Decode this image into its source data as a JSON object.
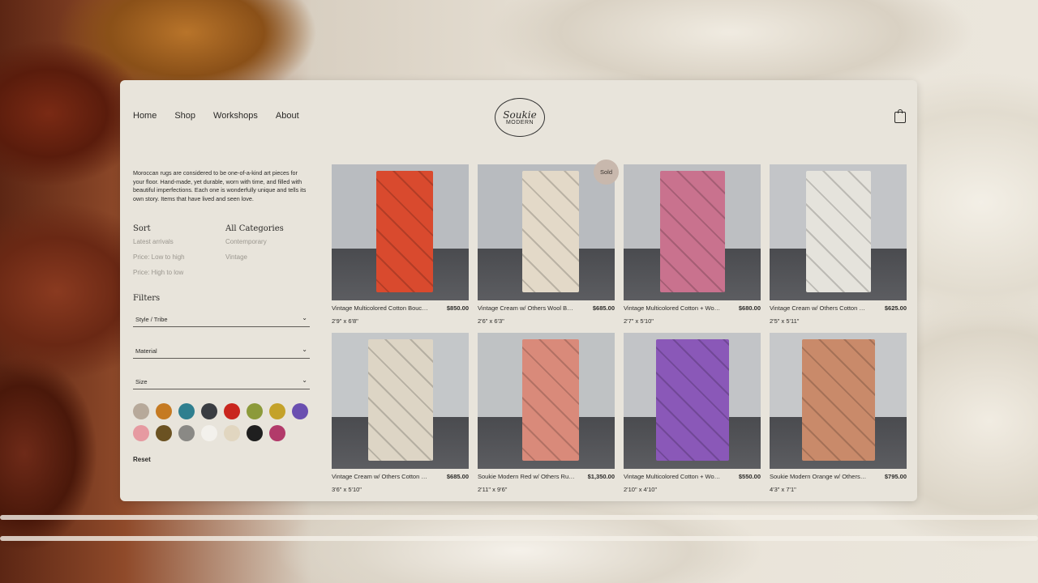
{
  "nav": {
    "items": [
      "Home",
      "Shop",
      "Workshops",
      "About"
    ]
  },
  "logo": {
    "line1": "Soukie",
    "line2": "MODERN"
  },
  "intro": "Moroccan rugs are considered to be one-of-a-kind art pieces for your floor. Hand-made, yet durable, worn with time, and filled with beautiful imperfections. Each one is wonderfully unique and tells its own story. Items that have lived and seen love.",
  "sort": {
    "title": "Sort",
    "options": [
      "Latest arrivals",
      "Price: Low to high",
      "Price: High to low"
    ]
  },
  "categories": {
    "title": "All Categories",
    "options": [
      "Contemporary",
      "Vintage"
    ]
  },
  "filters": {
    "title": "Filters",
    "selects": [
      "Style / Tribe",
      "Material",
      "Size"
    ],
    "reset": "Reset",
    "swatch_colors": [
      "#b7a99a",
      "#c57a22",
      "#2f7f8f",
      "#3a3d42",
      "#c9261e",
      "#8c9a3a",
      "#c4a22a",
      "#6a4fb0",
      "#e69aa1",
      "#6b5222",
      "#8a8985",
      "#f3f1ec",
      "#e1d6c0",
      "#1f1f1f",
      "#b23a6a"
    ]
  },
  "products": [
    {
      "name": "Vintage Multicolored Cotton Boucherouite Rug",
      "price": "$850.00",
      "size": "2'9\" x 6'8\"",
      "sold": "",
      "sky": "#b9bcc0",
      "rug": "#d94a2e"
    },
    {
      "name": "Vintage Cream w/ Others Wool Beni Ourain Runner",
      "price": "$685.00",
      "size": "2'6\" x 6'3\"",
      "sold": "Sold",
      "sky": "#b8bbbf",
      "rug": "#e3d9c8"
    },
    {
      "name": "Vintage Multicolored Cotton + Wool Runner",
      "price": "$680.00",
      "size": "2'7\" x 5'10\"",
      "sold": "",
      "sky": "#bdbfc2",
      "rug": "#c9728e"
    },
    {
      "name": "Vintage Cream w/ Others Cotton Runner",
      "price": "$625.00",
      "size": "2'5\" x 5'11\"",
      "sold": "",
      "sky": "#c3c5c8",
      "rug": "#e5e3dc"
    },
    {
      "name": "Vintage Cream w/ Others Cotton Rug",
      "price": "$685.00",
      "size": "3'6\" x 5'10\"",
      "sold": "",
      "sky": "#c4c7c9",
      "rug": "#ddd5c5"
    },
    {
      "name": "Soukie Modern Red w/ Others Runner",
      "price": "$1,350.00",
      "size": "2'11\" x 9'6\"",
      "sold": "",
      "sky": "#bfc2c4",
      "rug": "#d98a7a"
    },
    {
      "name": "Vintage Multicolored Cotton + Wool Rug",
      "price": "$550.00",
      "size": "2'10\" x 4'10\"",
      "sold": "",
      "sky": "#c2c4c7",
      "rug": "#8a58b8"
    },
    {
      "name": "Soukie Modern Orange w/ Others Rug",
      "price": "$795.00",
      "size": "4'3\" x 7'1\"",
      "sold": "",
      "sky": "#c6c8ca",
      "rug": "#c98a6a"
    }
  ]
}
